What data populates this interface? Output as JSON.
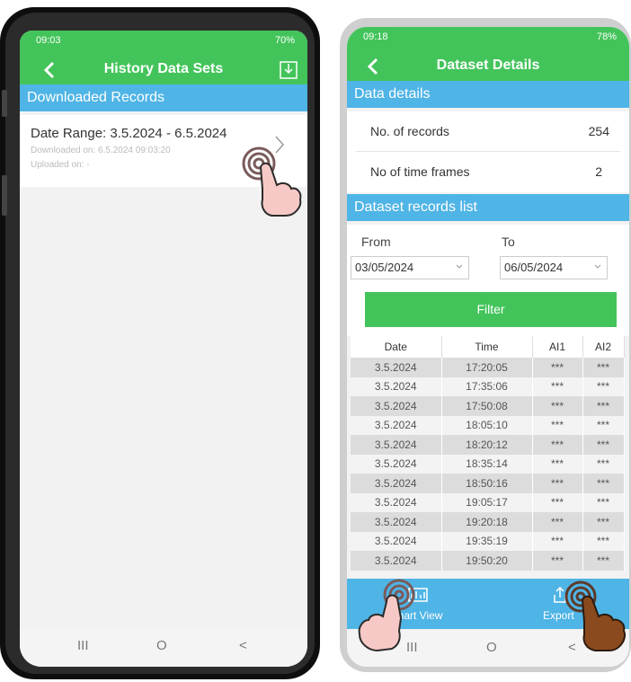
{
  "left_phone": {
    "status": {
      "time": "09:03",
      "right": "70%"
    },
    "appbar": {
      "title": "History Data Sets"
    },
    "section_title": "Downloaded Records",
    "record": {
      "title": "Date Range: 3.5.2024 - 6.5.2024",
      "downloaded": "Downloaded on: 6.5.2024 09:03:20",
      "uploaded": "Uploaded on: -"
    }
  },
  "right_phone": {
    "status": {
      "time": "09:18",
      "right": "78%"
    },
    "appbar": {
      "title": "Dataset Details"
    },
    "data_details": {
      "title": "Data details",
      "rows": [
        {
          "label": "No. of records",
          "value": "254"
        },
        {
          "label": "No of time frames",
          "value": "2"
        }
      ]
    },
    "records_list": {
      "title": "Dataset records list",
      "from_label": "From",
      "to_label": "To",
      "from_value": "03/05/2024",
      "to_value": "06/05/2024",
      "filter_label": "Filter",
      "columns": [
        "Date",
        "Time",
        "AI1",
        "AI2"
      ],
      "rows": [
        [
          "3.5.2024",
          "17:20:05",
          "***",
          "***"
        ],
        [
          "3.5.2024",
          "17:35:06",
          "***",
          "***"
        ],
        [
          "3.5.2024",
          "17:50:08",
          "***",
          "***"
        ],
        [
          "3.5.2024",
          "18:05:10",
          "***",
          "***"
        ],
        [
          "3.5.2024",
          "18:20:12",
          "***",
          "***"
        ],
        [
          "3.5.2024",
          "18:35:14",
          "***",
          "***"
        ],
        [
          "3.5.2024",
          "18:50:16",
          "***",
          "***"
        ],
        [
          "3.5.2024",
          "19:05:17",
          "***",
          "***"
        ],
        [
          "3.5.2024",
          "19:20:18",
          "***",
          "***"
        ],
        [
          "3.5.2024",
          "19:35:19",
          "***",
          "***"
        ],
        [
          "3.5.2024",
          "19:50:20",
          "***",
          "***"
        ]
      ]
    },
    "bottom": {
      "chart_label": "Chart View",
      "export_label": "Export"
    }
  },
  "navbar": {
    "recents": "III",
    "home": "O",
    "back": "<"
  },
  "colors": {
    "green": "#43c45a",
    "blue": "#4fb4e6",
    "skin": "#f7c9c6",
    "dark_skin": "#8a4a1e"
  }
}
